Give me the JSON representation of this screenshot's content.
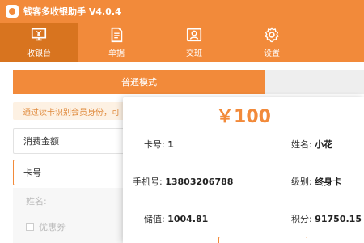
{
  "window": {
    "title": "钱客多收银助手 V4.0.4"
  },
  "toolbar": {
    "items": [
      {
        "label": "收银台",
        "icon": "yen-register-icon",
        "active": true
      },
      {
        "label": "单据",
        "icon": "document-icon",
        "active": false
      },
      {
        "label": "交班",
        "icon": "handover-icon",
        "active": false
      },
      {
        "label": "设置",
        "icon": "gear-icon",
        "active": false
      }
    ]
  },
  "mode": {
    "active_label": "普通模式"
  },
  "notice": {
    "text": "通过读卡识别会员身份，可"
  },
  "form": {
    "amount_label": "消费金额",
    "card_label": "卡号",
    "name_label": "姓名:",
    "coupon_label": "优惠券"
  },
  "member": {
    "amount": "￥100",
    "card_no_label": "卡号:",
    "card_no": "1",
    "name_label": "姓名:",
    "name": "小花",
    "phone_label": "手机号:",
    "phone": "13803206788",
    "level_label": "级别:",
    "level": "终身卡",
    "balance_label": "储值:",
    "balance": "1004.81",
    "points_label": "积分:",
    "points": "91750.15"
  },
  "colors": {
    "accent": "#f28a3a",
    "accent_dark": "#d8741f"
  }
}
